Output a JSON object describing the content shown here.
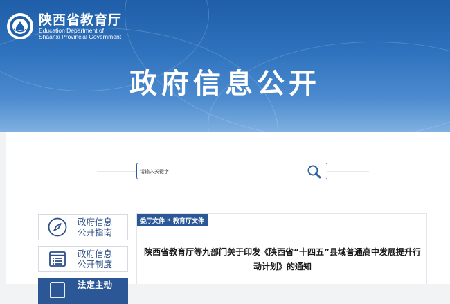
{
  "header": {
    "site_name_cn": "陕西省教育厅",
    "site_name_en_line1": "Education Department of",
    "site_name_en_line2": "Shaanxi Provincial Government",
    "page_heading": "政府信息公开"
  },
  "search": {
    "placeholder": "请输入关键字",
    "value": ""
  },
  "sidebar": {
    "items": [
      {
        "line1": "政府信息",
        "line2": "公开指南",
        "icon": "compass-icon",
        "active": false
      },
      {
        "line1": "政府信息",
        "line2": "公开制度",
        "icon": "list-document-icon",
        "active": false
      },
      {
        "line1": "法定主动",
        "line2": "",
        "icon": "book-icon",
        "active": true
      }
    ]
  },
  "breadcrumb": {
    "part1": "委厅文件",
    "separator": "»",
    "part2": "教育厅文件"
  },
  "article": {
    "title_line1": "陕西省教育厅等九部门关于印发《陕西省“十四五”县域普通高中发展提升行",
    "title_line2": "动计划》的通知"
  },
  "colors": {
    "banner_blue": "#2f72bd",
    "nav_active": "#2b5797",
    "nav_text": "#2b4f86"
  }
}
